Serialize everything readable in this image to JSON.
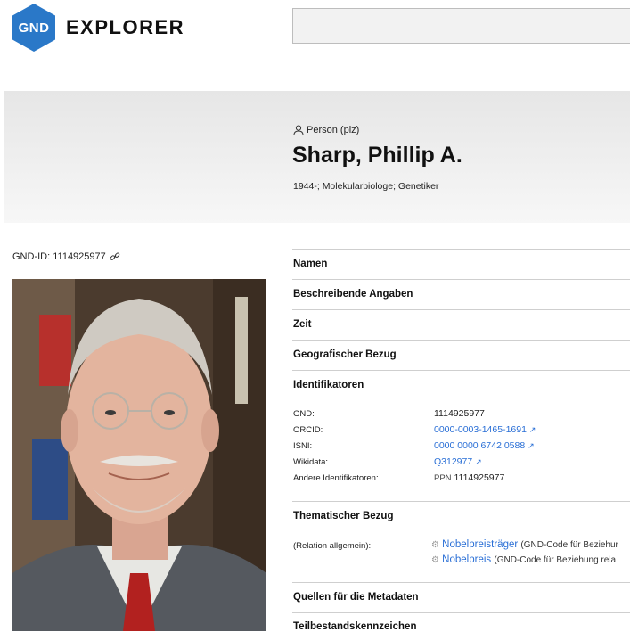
{
  "header": {
    "logo_mark": "GND",
    "logo_text": "EXPLORER",
    "search_value": ""
  },
  "entity": {
    "type_label": "Person (piz)",
    "name": "Sharp, Phillip A.",
    "subtitle": "1944-; Molekularbiologe; Genetiker"
  },
  "sidebar": {
    "gnd_id": "GND-ID: 1114925977"
  },
  "sections": {
    "namen": "Namen",
    "beschreibende": "Beschreibende Angaben",
    "zeit": "Zeit",
    "geo": "Geografischer Bezug",
    "identifikatoren": "Identifikatoren",
    "thematisch": "Thematischer Bezug",
    "quellen": "Quellen für die Metadaten",
    "teilbestand": "Teilbestandskennzeichen"
  },
  "identifiers": {
    "gnd_label": "GND:",
    "gnd_value": "1114925977",
    "orcid_label": "ORCID:",
    "orcid_value": "0000-0003-1465-1691",
    "isni_label": "ISNI:",
    "isni_value": "0000 0000 6742 0588",
    "wikidata_label": "Wikidata:",
    "wikidata_value": "Q312977",
    "other_label": "Andere Identifikatoren:",
    "other_prefix": "PPN",
    "other_value": "1114925977"
  },
  "relations": {
    "label": "(Relation allgemein):",
    "items": [
      {
        "name": "Nobelpreisträger",
        "code": "(GND-Code für Beziehur"
      },
      {
        "name": "Nobelpreis",
        "code": "(GND-Code für Beziehung rela"
      }
    ]
  },
  "colors": {
    "brand": "#2a78c8",
    "link": "#2a6fd6"
  }
}
